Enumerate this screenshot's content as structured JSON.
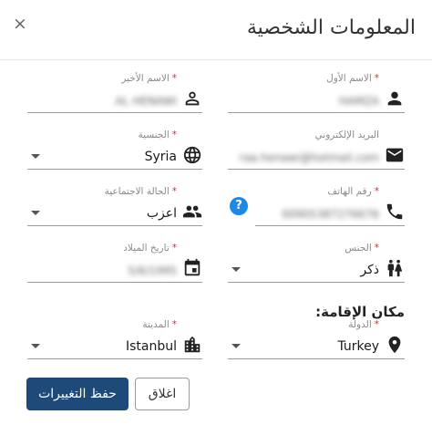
{
  "dialog": {
    "title": "المعلومات الشخصية",
    "close_label": "×"
  },
  "fields": {
    "first_name": {
      "label": "الاسم الأول",
      "required": "*",
      "value": "HAMZA"
    },
    "last_name": {
      "label": "الاسم الأخير",
      "required": "*",
      "value": "AL HENAWI"
    },
    "email": {
      "label": "البريد الإلكتروني",
      "value": "raa.henawi@hotmail.com"
    },
    "nationality": {
      "label": "الجنسية",
      "required": "*",
      "value": "Syria"
    },
    "phone": {
      "label": "رقم الهاتف",
      "required": "*",
      "value": "00905387276676"
    },
    "marital_status": {
      "label": "الحالة الاجتماعية",
      "required": "*",
      "value": "اعزب"
    },
    "gender": {
      "label": "الجنس",
      "required": "*",
      "value": "ذكر"
    },
    "birth_date": {
      "label": "تاريخ الميلاد",
      "required": "*",
      "value": "5/6/1995"
    },
    "country": {
      "label": "الدولة",
      "required": "*",
      "value": "Turkey"
    },
    "city": {
      "label": "المدينة",
      "required": "*",
      "value": "Istanbul"
    }
  },
  "help_badge": "?",
  "residence_section": "مكان الإقامة:",
  "buttons": {
    "save": "حفظ التغييرات",
    "close": "اغلاق"
  },
  "colors": {
    "primary": "#1e4a7a",
    "required": "#d32f2f",
    "help": "#1e88e5"
  }
}
